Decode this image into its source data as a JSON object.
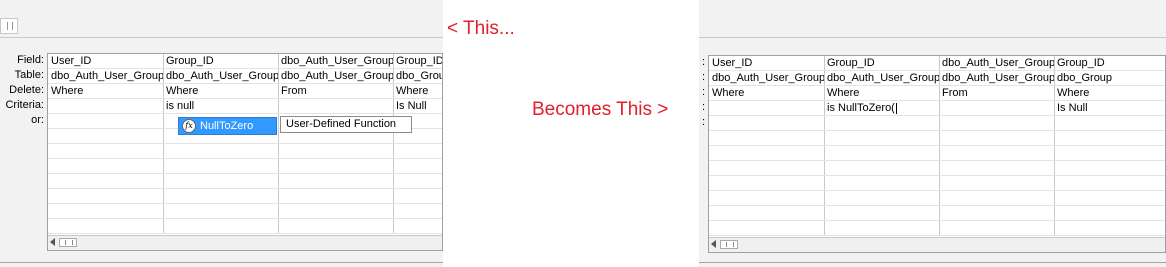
{
  "captions": {
    "this": "< This...",
    "becomes": "Becomes This >"
  },
  "row_labels": [
    "Field:",
    "Table:",
    "Delete:",
    "Criteria:",
    "or:"
  ],
  "right_row_labels": [
    ":",
    ":",
    ":",
    ":",
    ":"
  ],
  "left_grid": {
    "columns": [
      {
        "field": "User_ID",
        "table": "dbo_Auth_User_Groups",
        "delete": "Where",
        "criteria": "",
        "or": ""
      },
      {
        "field": "Group_ID",
        "table": "dbo_Auth_User_Groups",
        "delete": "Where",
        "criteria": "is null",
        "or": ""
      },
      {
        "field": "dbo_Auth_User_Groups.*",
        "table": "dbo_Auth_User_Groups",
        "delete": "From",
        "criteria": "",
        "or": ""
      },
      {
        "field": "Group_ID",
        "table": "dbo_Group",
        "delete": "Where",
        "criteria": "Is Null",
        "or": ""
      }
    ]
  },
  "right_grid": {
    "columns": [
      {
        "field": "User_ID",
        "table": "dbo_Auth_User_Groups",
        "delete": "Where",
        "criteria": "",
        "or": ""
      },
      {
        "field": "Group_ID",
        "table": "dbo_Auth_User_Groups",
        "delete": "Where",
        "criteria": "is NullToZero(",
        "or": ""
      },
      {
        "field": "dbo_Auth_User_Groups.*",
        "table": "dbo_Auth_User_Groups",
        "delete": "From",
        "criteria": "",
        "or": ""
      },
      {
        "field": "Group_ID",
        "table": "dbo_Group",
        "delete": "Where",
        "criteria": "Is Null",
        "or": ""
      }
    ]
  },
  "autocomplete": {
    "item": "NullToZero",
    "icon": "function-icon"
  },
  "tooltip": "User-Defined Function"
}
